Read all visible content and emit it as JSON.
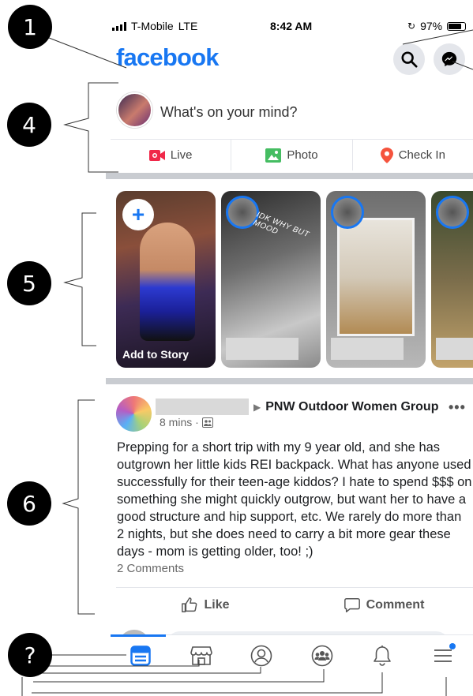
{
  "status_bar": {
    "carrier": "T-Mobile",
    "network": "LTE",
    "time": "8:42 AM",
    "battery": "97%"
  },
  "header": {
    "logo": "facebook",
    "search_icon": "search-icon",
    "messenger_icon": "messenger-icon"
  },
  "composer": {
    "prompt": "What's on your mind?",
    "actions": [
      {
        "label": "Live",
        "icon": "live-video-icon",
        "color": "#f02849"
      },
      {
        "label": "Photo",
        "icon": "photo-icon",
        "color": "#45bd62"
      },
      {
        "label": "Check In",
        "icon": "location-pin-icon",
        "color": "#f5533d"
      }
    ]
  },
  "stories": {
    "own_label": "Add to Story",
    "add_symbol": "+",
    "story2_overlay": "IDK WHY BUT MOOD"
  },
  "post": {
    "group": "PNW Outdoor Women Group",
    "time": "8 mins ·",
    "more": "•••",
    "body": "Prepping for a short trip with my 9 year old, and she has outgrown her little kids REI backpack. What has anyone used successfully for their teen-age kiddos? I hate to spend $$$ on something she might quickly outgrow, but want her to have a good structure and hip support, etc. We rarely do more than 2 nights, but she does need to carry a bit more gear these days - mom is getting older, too! ;)",
    "comments": "2 Comments",
    "like_label": "Like",
    "comment_label": "Comment"
  },
  "tab_bar": {
    "tabs": [
      "news-feed-icon",
      "marketplace-icon",
      "profile-icon",
      "groups-icon",
      "notifications-icon",
      "menu-icon"
    ]
  },
  "callouts": {
    "c1": "1",
    "c4": "4",
    "c5": "5",
    "c6": "6",
    "cq": "?"
  },
  "colors": {
    "brand": "#1877f2",
    "divider": "#c9ccd1"
  }
}
